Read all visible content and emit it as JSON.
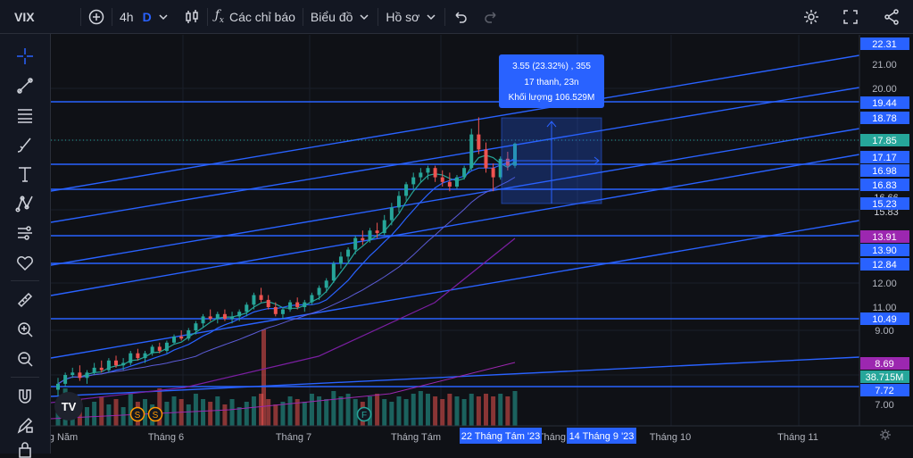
{
  "toolbar": {
    "symbol": "VIX",
    "interval": "4h",
    "interval_mode": "D",
    "indicators_label": "Các chỉ báo",
    "chart_type_label": "Biểu đồ",
    "profile_label": "Hồ sơ"
  },
  "tooltip": {
    "line1": "3.55 (23.32%) , 355",
    "line2": "17 thanh, 23n",
    "line3": "Khối lượng 106.529M"
  },
  "price_axis": {
    "ticks": [
      "22.31",
      "21.00",
      "20.00",
      "19.44",
      "18.78",
      "17.85",
      "17.17",
      "16.98",
      "16.83",
      "15.23",
      "13.91",
      "13.90",
      "12.84",
      "12.00",
      "11.00",
      "10.49",
      "9.00",
      "8.69",
      "38.715M",
      "7.72",
      "7.00"
    ],
    "partial": [
      "18.00",
      "16.66",
      "15.83"
    ]
  },
  "time_axis": {
    "labels": [
      "g Năm",
      "Tháng 6",
      "Tháng 7",
      "Tháng Tám",
      "Tháng 9",
      "Tháng 10",
      "Tháng 11"
    ],
    "highlight_start": "22 Tháng Tám '23",
    "highlight_end": "14 Tháng 9 '23"
  },
  "badges": {
    "split": "S",
    "earnings": "F"
  },
  "logo_text": "TV",
  "icons": [
    "crosshair-icon",
    "trendline-icon",
    "fib-icon",
    "brush-icon",
    "text-icon",
    "pattern-icon",
    "forecast-icon",
    "heart-icon",
    "ruler-icon",
    "zoom-in-icon",
    "zoom-out-icon",
    "magnet-icon",
    "lock-draw-icon",
    "lock-icon"
  ],
  "colors": {
    "up": "#26a69a",
    "down": "#ef5350",
    "line": "#2962ff",
    "accent": "#2962ff",
    "ma_purple": "#7b1fa2"
  },
  "chart_data": {
    "type": "candlestick",
    "ylim": [
      6.8,
      22.6
    ],
    "candles": [
      [
        7.5,
        7.9,
        7.3,
        7.7
      ],
      [
        7.7,
        8.1,
        7.6,
        8.0
      ],
      [
        8.0,
        8.3,
        7.9,
        8.1
      ],
      [
        8.1,
        8.4,
        7.8,
        7.9
      ],
      [
        7.9,
        8.2,
        7.7,
        8.1
      ],
      [
        8.1,
        8.5,
        8.0,
        8.3
      ],
      [
        8.3,
        8.6,
        8.1,
        8.2
      ],
      [
        8.2,
        8.7,
        8.1,
        8.6
      ],
      [
        8.6,
        8.8,
        8.3,
        8.4
      ],
      [
        8.4,
        8.7,
        8.2,
        8.5
      ],
      [
        8.5,
        9.0,
        8.4,
        8.9
      ],
      [
        8.9,
        9.1,
        8.6,
        8.7
      ],
      [
        8.7,
        9.0,
        8.5,
        8.9
      ],
      [
        8.9,
        9.3,
        8.8,
        9.2
      ],
      [
        9.2,
        9.4,
        8.9,
        9.0
      ],
      [
        9.0,
        9.5,
        8.9,
        9.4
      ],
      [
        9.4,
        9.8,
        9.3,
        9.7
      ],
      [
        9.7,
        10.0,
        9.5,
        9.6
      ],
      [
        9.6,
        10.1,
        9.5,
        10.0
      ],
      [
        10.0,
        10.4,
        9.8,
        10.3
      ],
      [
        10.3,
        10.7,
        10.1,
        10.6
      ],
      [
        10.6,
        10.9,
        10.4,
        10.5
      ],
      [
        10.5,
        10.8,
        10.3,
        10.7
      ],
      [
        10.7,
        10.9,
        10.4,
        10.5
      ],
      [
        10.5,
        10.8,
        10.3,
        10.6
      ],
      [
        10.6,
        10.9,
        10.4,
        10.8
      ],
      [
        10.8,
        11.2,
        10.6,
        11.1
      ],
      [
        11.1,
        11.6,
        10.9,
        11.5
      ],
      [
        11.5,
        11.8,
        11.2,
        11.3
      ],
      [
        11.3,
        11.5,
        10.9,
        11.0
      ],
      [
        11.0,
        11.2,
        10.6,
        10.7
      ],
      [
        10.7,
        11.0,
        10.5,
        10.9
      ],
      [
        10.9,
        11.3,
        10.8,
        11.2
      ],
      [
        11.2,
        11.4,
        10.9,
        11.0
      ],
      [
        11.0,
        11.3,
        10.8,
        11.2
      ],
      [
        11.2,
        11.6,
        11.1,
        11.5
      ],
      [
        11.5,
        11.9,
        11.3,
        11.8
      ],
      [
        11.8,
        12.2,
        11.6,
        12.1
      ],
      [
        12.1,
        12.9,
        12.0,
        12.8
      ],
      [
        12.8,
        13.3,
        12.6,
        13.1
      ],
      [
        13.1,
        13.5,
        12.9,
        13.4
      ],
      [
        13.4,
        14.0,
        13.2,
        13.9
      ],
      [
        13.9,
        14.2,
        13.6,
        13.8
      ],
      [
        13.8,
        14.3,
        13.7,
        14.2
      ],
      [
        14.2,
        14.5,
        13.9,
        14.1
      ],
      [
        14.1,
        14.8,
        14.0,
        14.6
      ],
      [
        14.6,
        15.3,
        14.4,
        15.1
      ],
      [
        15.1,
        15.8,
        14.9,
        15.6
      ],
      [
        15.6,
        16.2,
        15.4,
        16.1
      ],
      [
        16.1,
        16.6,
        15.9,
        16.4
      ],
      [
        16.4,
        16.8,
        16.2,
        16.6
      ],
      [
        16.6,
        16.9,
        16.3,
        16.8
      ],
      [
        16.8,
        16.9,
        16.2,
        16.4
      ],
      [
        16.4,
        16.7,
        16.0,
        16.2
      ],
      [
        16.2,
        16.6,
        15.8,
        16.0
      ],
      [
        16.0,
        16.5,
        15.9,
        16.4
      ],
      [
        16.4,
        16.9,
        16.3,
        16.8
      ],
      [
        16.8,
        18.4,
        16.7,
        18.2
      ],
      [
        18.2,
        18.8,
        17.4,
        17.6
      ],
      [
        17.6,
        17.9,
        16.6,
        16.8
      ],
      [
        16.8,
        17.0,
        15.8,
        16.4
      ],
      [
        16.4,
        17.3,
        16.3,
        17.2
      ],
      [
        17.2,
        17.5,
        16.7,
        16.9
      ],
      [
        16.9,
        17.9,
        16.8,
        17.85
      ]
    ],
    "volumes": [
      0.3,
      0.7,
      0.4,
      0.5,
      0.35,
      0.45,
      0.55,
      0.4,
      0.5,
      0.35,
      0.6,
      0.45,
      0.5,
      0.4,
      0.7,
      0.45,
      0.55,
      0.5,
      0.4,
      0.6,
      0.5,
      0.45,
      0.55,
      0.4,
      0.5,
      0.35,
      0.45,
      0.55,
      0.6,
      0.5,
      0.4,
      0.45,
      0.55,
      0.5,
      0.45,
      0.6,
      0.55,
      0.5,
      0.65,
      0.55,
      0.6,
      0.5,
      0.45,
      0.55,
      0.6,
      0.5,
      0.45,
      0.55,
      0.5,
      0.6,
      0.65,
      0.6,
      0.55,
      0.5,
      0.6,
      0.55,
      0.5,
      0.6,
      0.55,
      0.6,
      0.55,
      0.6,
      0.55,
      0.65
    ]
  }
}
